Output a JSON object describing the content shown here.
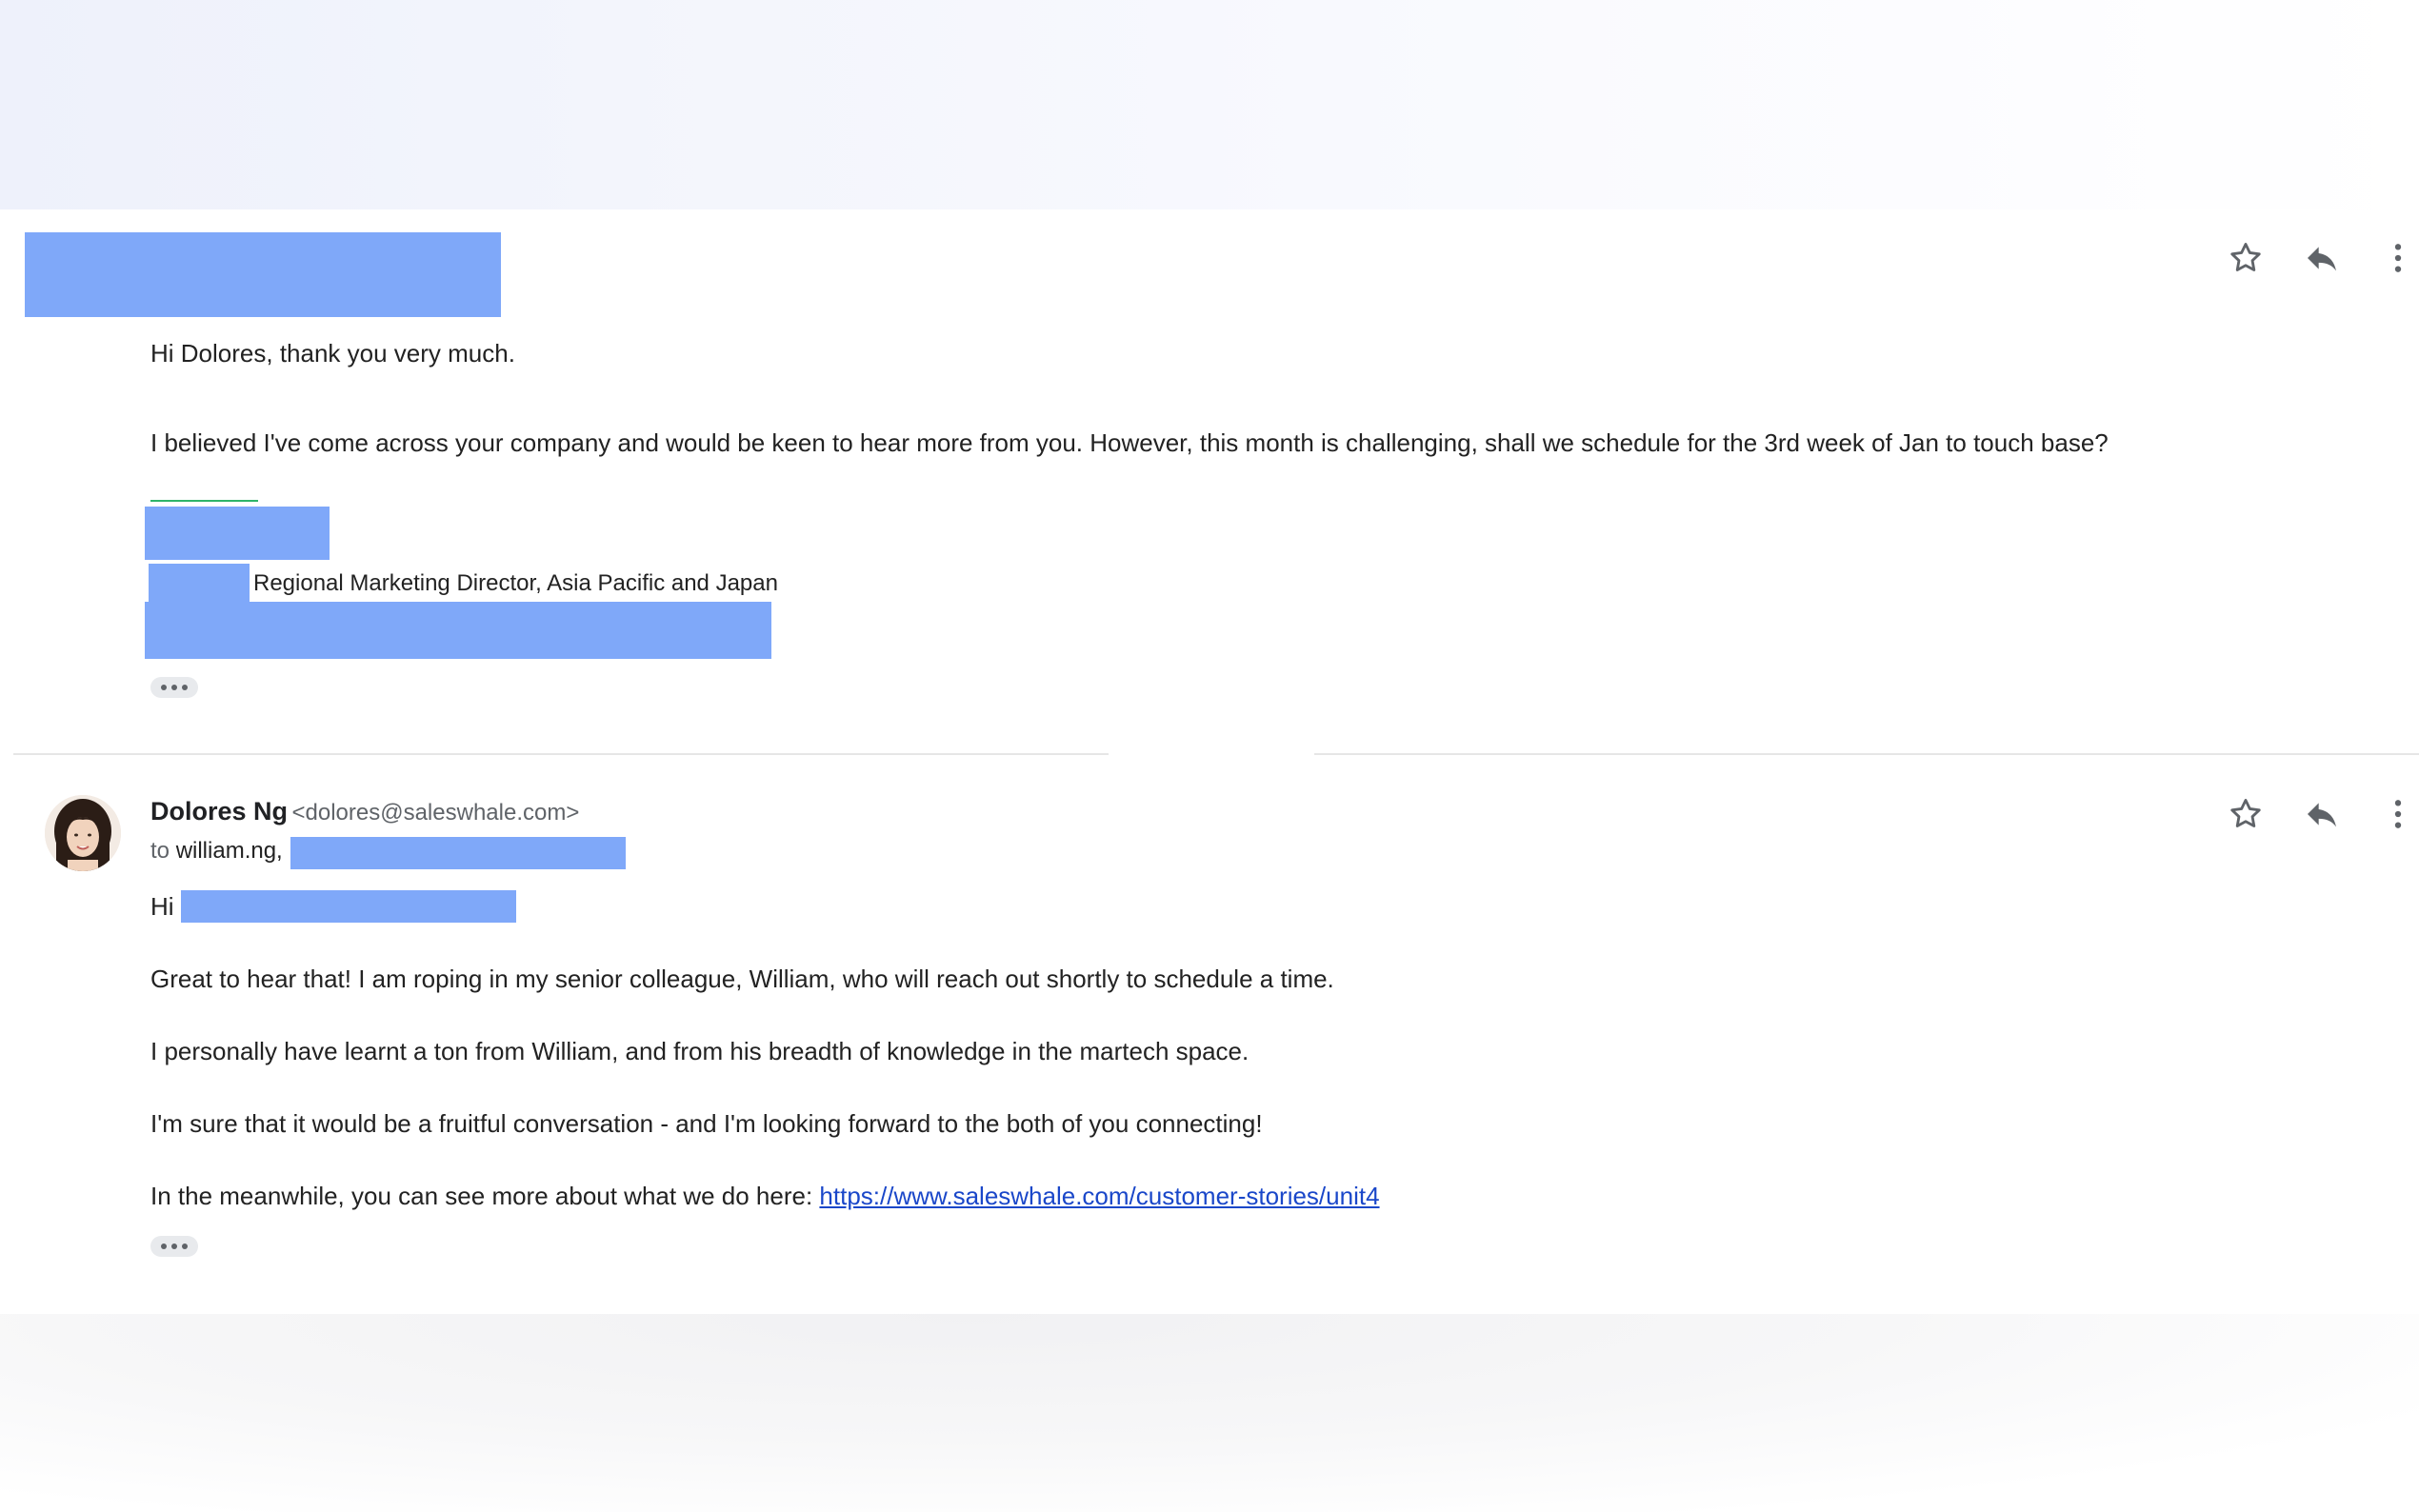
{
  "colors": {
    "redaction": "#7fa8f9",
    "link": "#1a47c9",
    "signature_rule": "#2fb56a"
  },
  "message1": {
    "greeting": "Hi Dolores, thank you very much.",
    "body": "I believed I've come across your company and would be keen to hear more from you. However, this month is challenging, shall we schedule for the 3rd week of Jan to touch base?",
    "signature_title": "Regional Marketing Director, Asia Pacific and Japan",
    "actions": {
      "star_icon": "star-outline-icon",
      "reply_icon": "reply-icon",
      "more_icon": "more-vertical-icon"
    },
    "show_trimmed_icon": "ellipsis-icon"
  },
  "message2": {
    "sender_name": "Dolores Ng",
    "sender_email": "<dolores@saleswhale.com>",
    "to_label": "to",
    "to_value": "william.ng,",
    "greeting": "Hi",
    "paragraphs": [
      "Great to hear that! I am roping in my senior colleague, William, who will reach out shortly to schedule a time.",
      "I personally have learnt a ton from William, and from his breadth of knowledge in the martech space.",
      "I'm sure that it would be a fruitful conversation - and I'm looking forward to the both of you connecting!"
    ],
    "link_prefix": "In the meanwhile, you can see more about what we do here: ",
    "link_text": "https://www.saleswhale.com/customer-stories/unit4",
    "actions": {
      "star_icon": "star-outline-icon",
      "reply_icon": "reply-icon",
      "more_icon": "more-vertical-icon"
    },
    "show_trimmed_icon": "ellipsis-icon",
    "avatar_icon": "avatar-photo"
  }
}
